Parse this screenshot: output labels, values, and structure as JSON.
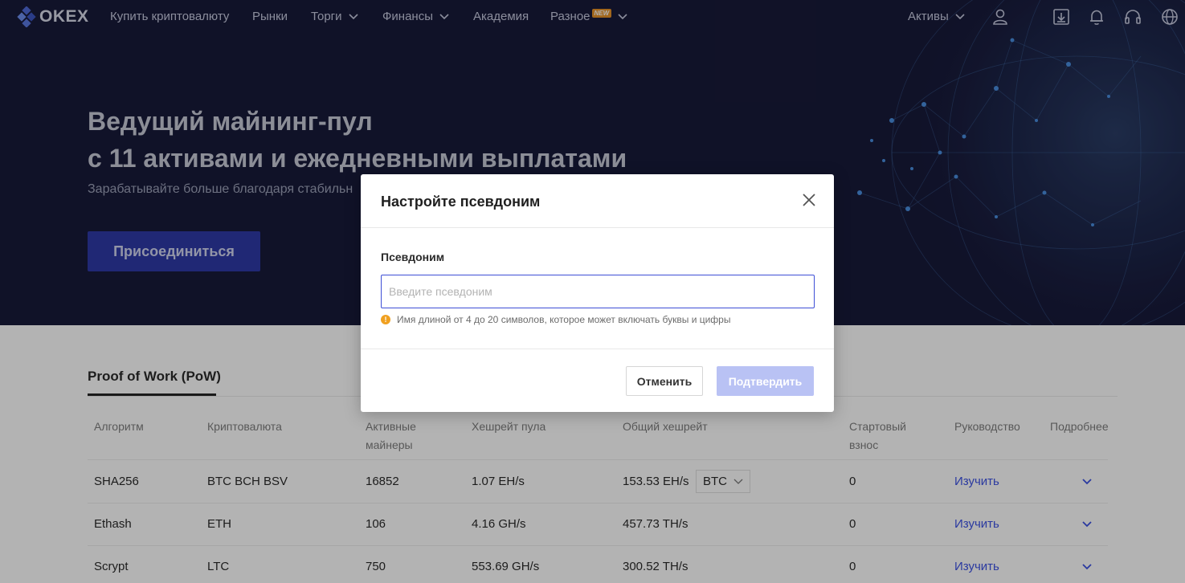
{
  "nav": {
    "logo_text": "OKEX",
    "items": [
      {
        "label": "Купить криптовалюту"
      },
      {
        "label": "Рынки"
      },
      {
        "label": "Торги"
      },
      {
        "label": "Финансы"
      },
      {
        "label": "Академия"
      },
      {
        "label": "Разное",
        "badge": "NEW"
      }
    ],
    "assets_label": "Активы"
  },
  "hero": {
    "title_line1": "Ведущий майнинг-пул",
    "title_line2": "с 11 активами и ежедневными выплатами",
    "subtitle": "Зарабатывайте больше благодаря стабильн",
    "join_label": "Присоединиться"
  },
  "content": {
    "tab_label": "Proof of Work (PoW)",
    "headers": [
      "Алгоритм",
      "Криптовалюта",
      "Активные майнеры",
      "Хешрейт пула",
      "Общий хешрейт",
      "Стартовый взнос",
      "Руководство",
      "Подробнее"
    ],
    "rows": [
      {
        "algo": "SHA256",
        "coins": "BTC BCH BSV",
        "miners": "16852",
        "pool_hashrate": "1.07 EH/s",
        "total_hashrate": "153.53 EH/s",
        "fee": "0",
        "guide": "Изучить"
      },
      {
        "algo": "Ethash",
        "coins": "ETH",
        "miners": "106",
        "pool_hashrate": "4.16 GH/s",
        "total_hashrate": "457.73 TH/s",
        "fee": "0",
        "guide": "Изучить"
      },
      {
        "algo": "Scrypt",
        "coins": "LTC",
        "miners": "750",
        "pool_hashrate": "553.69 GH/s",
        "total_hashrate": "300.52 TH/s",
        "fee": "0",
        "guide": "Изучить"
      }
    ],
    "coin_select_value": "BTC"
  },
  "modal": {
    "title": "Настройте псевдоним",
    "field_label": "Псевдоним",
    "placeholder": "Введите псевдоним",
    "hint": "Имя длиной от 4 до 20 символов, которое может включать буквы и цифры",
    "cancel_label": "Отменить",
    "confirm_label": "Подтвердить"
  },
  "colors": {
    "hero_bg": "#181a3a",
    "accent": "#2f3aa8",
    "input_border": "#3e4fd6",
    "confirm_disabled": "#b9c2f4",
    "warning": "#f0a020",
    "new_badge": "#e8942a"
  }
}
